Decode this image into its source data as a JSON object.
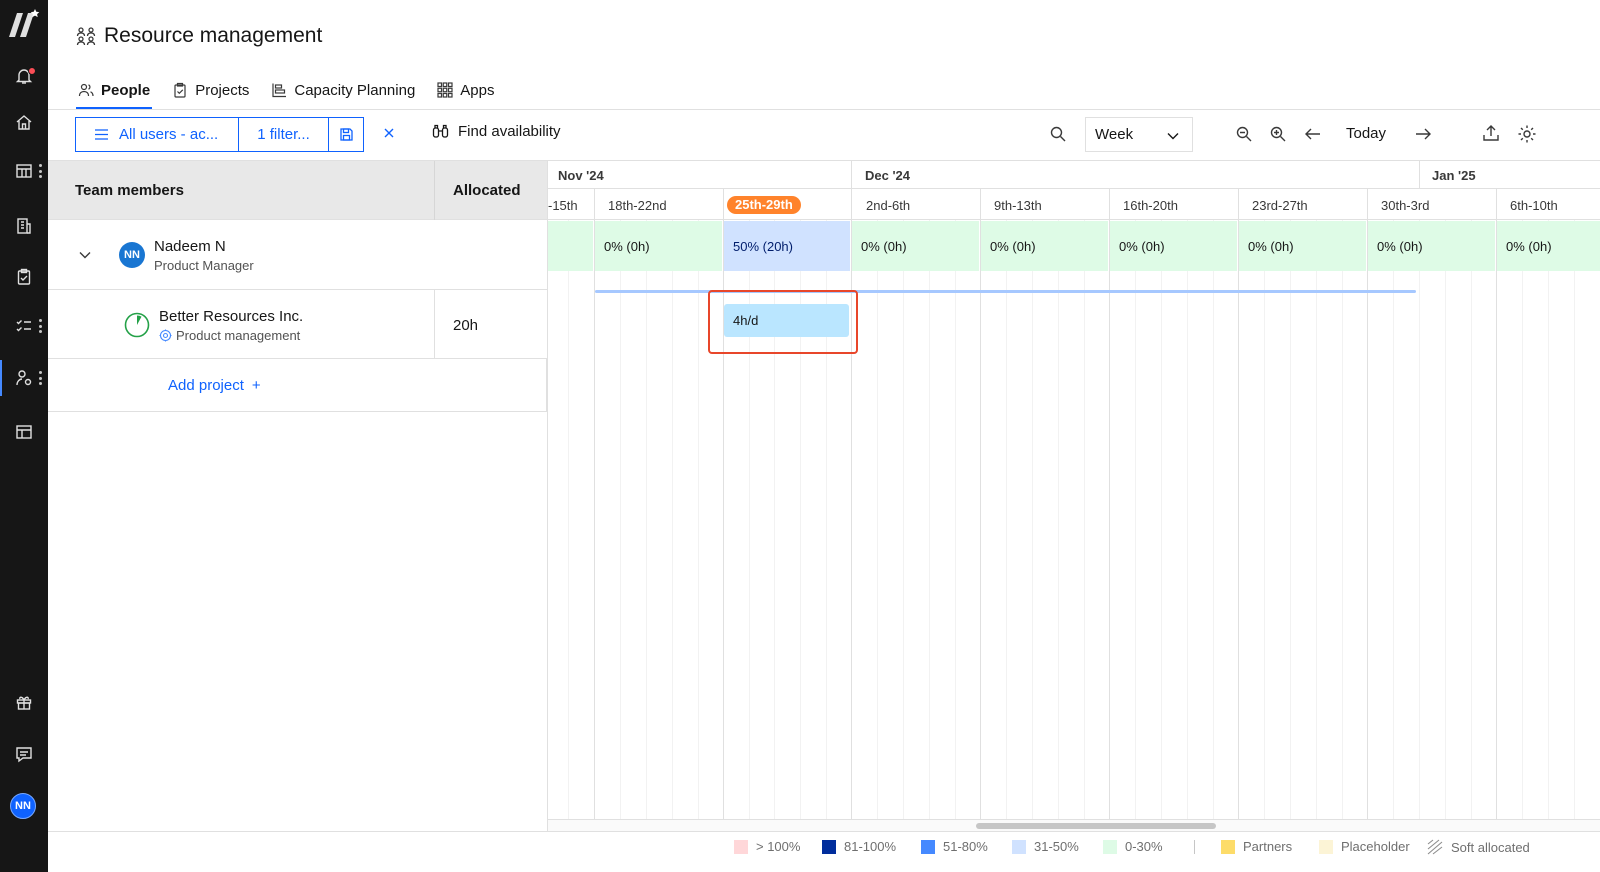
{
  "page": {
    "title": "Resource management"
  },
  "tabs": [
    {
      "label": "People",
      "active": true,
      "icon": "people-icon"
    },
    {
      "label": "Projects",
      "active": false,
      "icon": "clipboard-icon"
    },
    {
      "label": "Capacity Planning",
      "active": false,
      "icon": "capacity-icon"
    },
    {
      "label": "Apps",
      "active": false,
      "icon": "grid-icon"
    }
  ],
  "toolbar": {
    "users_filter": "All users - ac...",
    "filter_count": "1 filter...",
    "find_availability": "Find availability",
    "view_select": "Week",
    "today": "Today"
  },
  "table": {
    "col_members": "Team members",
    "col_allocated": "Allocated",
    "person": {
      "initials": "NN",
      "name": "Nadeem N",
      "role": "Product Manager"
    },
    "project": {
      "name": "Better Resources Inc.",
      "type": "Product management",
      "allocated": "20h"
    },
    "add_project": "Add project",
    "add_symbol": "+"
  },
  "timeline": {
    "months": [
      "Nov '24",
      "Dec '24",
      "Jan '25"
    ],
    "weeks": [
      "-15th",
      "18th-22nd",
      "25th-29th",
      "2nd-6th",
      "9th-13th",
      "16th-20th",
      "23rd-27th",
      "30th-3rd",
      "6th-10th"
    ],
    "current_week": "25th-29th",
    "utilization": [
      "",
      "0% (0h)",
      "50% (20h)",
      "0% (0h)",
      "0% (0h)",
      "0% (0h)",
      "0% (0h)",
      "0% (0h)",
      "0% (0h)"
    ],
    "allocation_label": "4h/d"
  },
  "legend": [
    {
      "label": "> 100%",
      "color": "#ffd7d9"
    },
    {
      "label": "81-100%",
      "color": "#002d9c"
    },
    {
      "label": "51-80%",
      "color": "#4589ff"
    },
    {
      "label": "31-50%",
      "color": "#d0e2ff"
    },
    {
      "label": "0-30%",
      "color": "#defbe6"
    },
    {
      "label": "Partners",
      "color": "#fddc69"
    },
    {
      "label": "Placeholder",
      "color": "#fcf4d6"
    },
    {
      "label": "Soft allocated",
      "color": "#e0e0e0"
    }
  ],
  "user": {
    "initials": "NN"
  },
  "colors": {
    "accent": "#0f62fe",
    "current_week": "#ff832b",
    "highlight": "#e8462a",
    "rail": "#161616"
  }
}
